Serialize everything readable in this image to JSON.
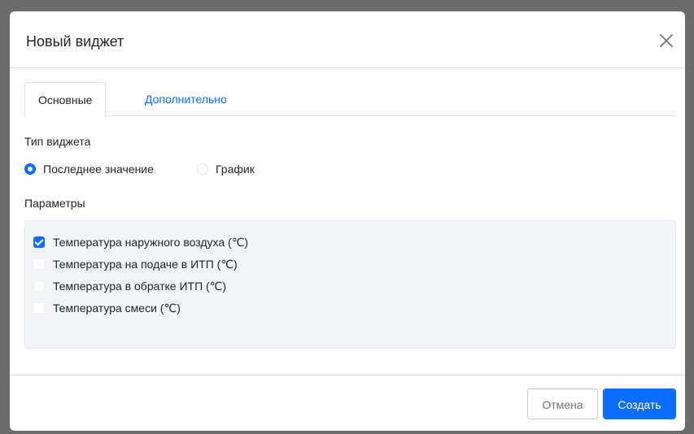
{
  "modal": {
    "title": "Новый виджет"
  },
  "tabs": [
    {
      "label": "Основные",
      "active": true
    },
    {
      "label": "Дополнительно",
      "active": false
    }
  ],
  "widget_type": {
    "label": "Тип виджета",
    "options": [
      {
        "label": "Последнее значение",
        "checked": true
      },
      {
        "label": "График",
        "checked": false
      }
    ]
  },
  "parameters": {
    "label": "Параметры",
    "items": [
      {
        "label": "Температура наружного воздуха (℃)",
        "checked": true
      },
      {
        "label": "Температура на подаче в ИТП (℃)",
        "checked": false
      },
      {
        "label": "Температура в обратке ИТП (℃)",
        "checked": false
      },
      {
        "label": "Температура смеси (℃)",
        "checked": false
      }
    ]
  },
  "footer": {
    "cancel_label": "Отмена",
    "create_label": "Создать"
  },
  "colors": {
    "accent": "#0d6efd",
    "overlay": "#6b6b6b",
    "params_background": "#f2f4f7"
  }
}
